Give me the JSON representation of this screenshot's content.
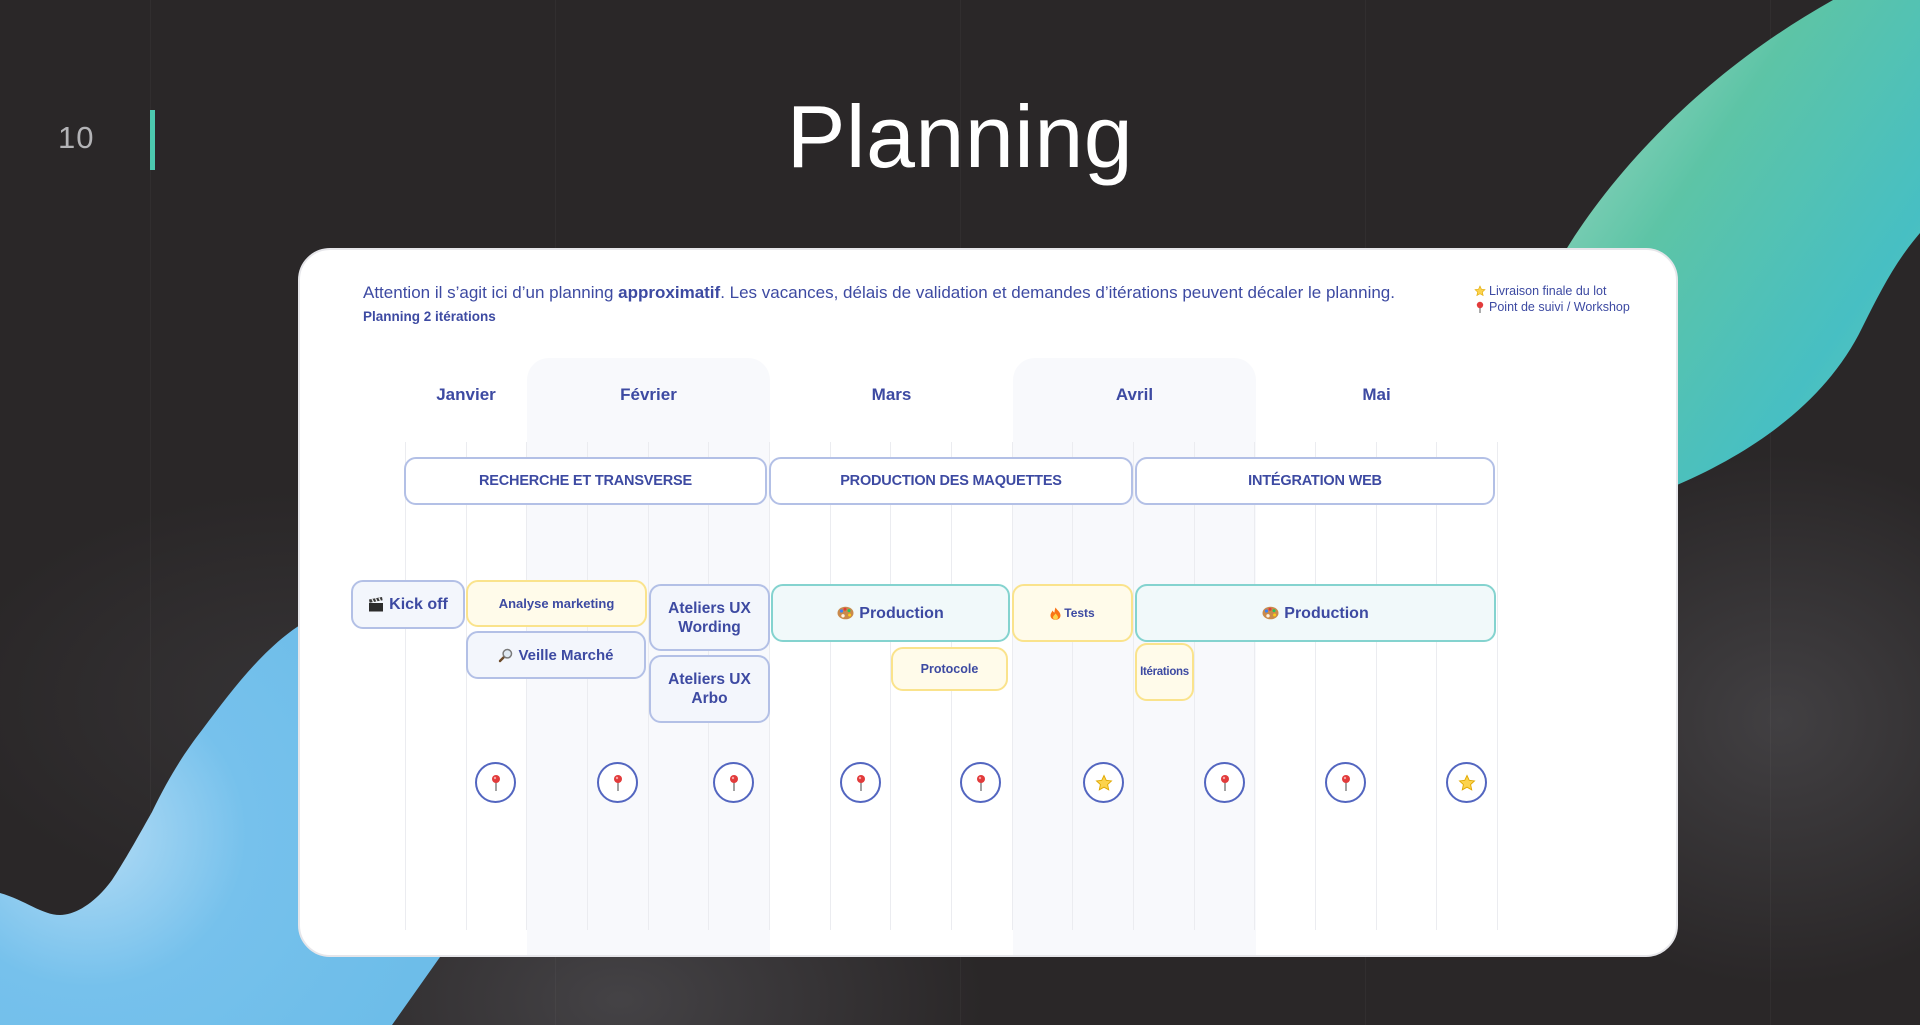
{
  "slide": {
    "page_number": "10",
    "title": "Planning",
    "accent_color": "#4cc8ae"
  },
  "card": {
    "intro_before": "Attention il s’agit ici d’un planning ",
    "intro_bold": "approximatif",
    "intro_after": ". Les vacances, délais de validation et demandes d’itérations peuvent décaler le planning.",
    "subtitle": "Planning 2 itérations",
    "legend": [
      {
        "icon": "star-icon",
        "label": "Livraison finale du lot"
      },
      {
        "icon": "pin-icon",
        "label": "Point de suivi / Workshop"
      }
    ]
  },
  "timeline": {
    "months": [
      {
        "label": "Janvier",
        "shaded": false
      },
      {
        "label": "Février",
        "shaded": true
      },
      {
        "label": "Mars",
        "shaded": false
      },
      {
        "label": "Avril",
        "shaded": true
      },
      {
        "label": "Mai",
        "shaded": false
      }
    ],
    "phases": [
      {
        "label": "RECHERCHE ET TRANSVERSE"
      },
      {
        "label": "PRODUCTION DES MAQUETTES"
      },
      {
        "label": "INTÉGRATION WEB"
      }
    ],
    "tasks": [
      {
        "label": "Kick off",
        "icon": "clapperboard-icon",
        "style": "blue"
      },
      {
        "label": "Analyse marketing",
        "icon": null,
        "style": "yellow"
      },
      {
        "label": "Veille Marché",
        "icon": "magnifier-icon",
        "style": "blue"
      },
      {
        "label": "Ateliers UX Wording",
        "icon": null,
        "style": "blue"
      },
      {
        "label": "Ateliers UX Arbo",
        "icon": null,
        "style": "blue"
      },
      {
        "label": "Production",
        "icon": "palette-icon",
        "style": "teal"
      },
      {
        "label": "Protocole",
        "icon": null,
        "style": "yellow"
      },
      {
        "label": "Tests",
        "icon": "fire-icon",
        "style": "yellow"
      },
      {
        "label": "Production",
        "icon": "palette-icon",
        "style": "teal"
      },
      {
        "label": "Itérations",
        "icon": null,
        "style": "yellow"
      }
    ],
    "milestones": [
      "pin",
      "pin",
      "pin",
      "pin",
      "pin",
      "star",
      "pin",
      "pin",
      "star"
    ]
  },
  "colors": {
    "text": "#3d4aa2",
    "blue_border": "#b3c0e6",
    "yellow_border": "#fae38c",
    "teal_border": "#84d3cf",
    "milestone_ring": "#5366c0"
  }
}
